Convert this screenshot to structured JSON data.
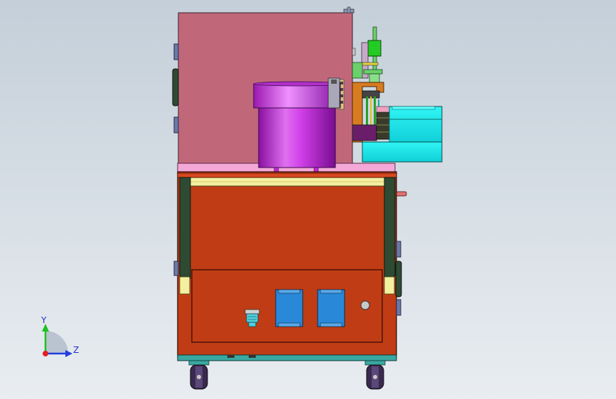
{
  "viewport": {
    "background_top": "#c4cfd9",
    "background_bottom": "#e9edf1"
  },
  "axis_triad": {
    "y_label": "Y",
    "z_label": "Z",
    "x_color": "#e02020",
    "y_color": "#20c020",
    "z_color": "#2040e0"
  },
  "colors": {
    "cabinet": "#c0687a",
    "hopper": "#c026d6",
    "base_body": "#c03c14",
    "side_rail": "#2e4a33",
    "top_bar": "#f5f0a0",
    "cyan_module": "#22eeee",
    "control_panel_button": "#2a88d8",
    "plate": "#f4a8d8",
    "wheel": "#3a2850"
  }
}
